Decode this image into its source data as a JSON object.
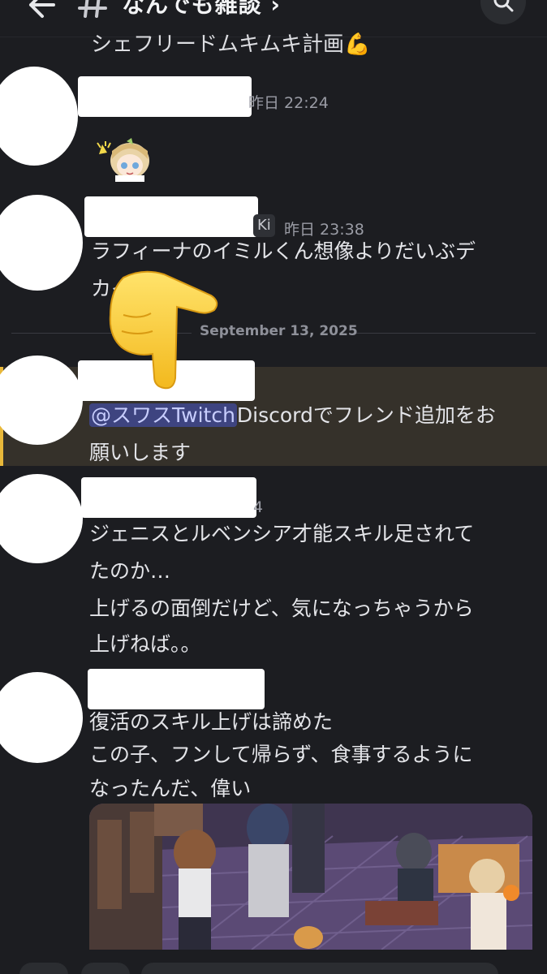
{
  "header": {
    "back_icon": "arrow-left-icon",
    "channel_icon": "hash-icon",
    "channel_name": "なんでも雑談 ›",
    "search_icon": "search-icon"
  },
  "previous_message": "シェフリードムキムキ計画💪",
  "messages": [
    {
      "timestamp": "昨日 22:24",
      "sticker": "sticker-chibi-girl"
    },
    {
      "tag": "Ki",
      "timestamp": "昨日 23:38",
      "lines": [
        "ラフィーナのイミルくん想像よりだいぶデ",
        "カイ"
      ]
    },
    {
      "mention": "@スワスTwitch",
      "text_after_mention": "Discordでフレンド追加をお",
      "line2": "願いします"
    },
    {
      "timestamp_fragment": "4",
      "lines": [
        "ジェニスとルベンシア才能スキル足されて",
        "たのか…",
        "上げるの面倒だけど、気になっちゃうから",
        "上げねば。。"
      ]
    },
    {
      "lines": [
        "復活のスキル上げは諦めた",
        "この子、フンして帰らず、食事するように",
        "なったんだ、偉い"
      ],
      "attachment": "game-screenshot-image"
    }
  ],
  "date_divider": "September 13, 2025",
  "overlay_emoji": "pointing-hand-emoji",
  "colors": {
    "background": "#1c1d21",
    "highlight": "#35312a",
    "highlight_bar": "#e8b83a",
    "mention_bg": "#3e4480",
    "mention_text": "#c7cdfd"
  }
}
